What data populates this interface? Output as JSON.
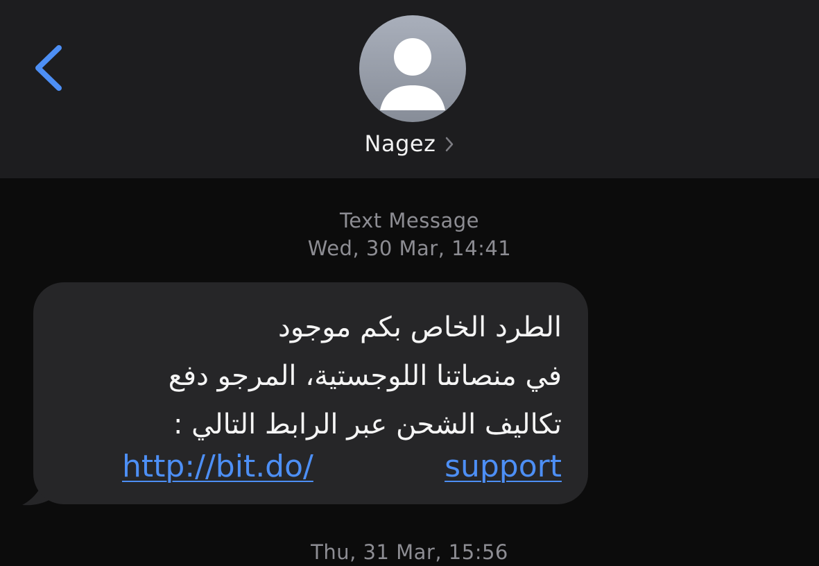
{
  "header": {
    "contact_name": "Nagez",
    "back_icon": "chevron-left-icon",
    "avatar_icon": "person-silhouette-icon",
    "accent_color": "#4d8ff5"
  },
  "conversation": {
    "message_type": "Text Message",
    "timestamp": "Wed, 30 Mar, 14:41",
    "message": {
      "lines": [
        "الطرد الخاص بكم موجود",
        "في منصاتنا اللوجستية، المرجو دفع",
        "تكاليف الشحن عبر الرابط التالي :"
      ],
      "link_part_1": "http://bit.do/",
      "link_part_2": "support"
    },
    "next_timestamp": "Thu, 31 Mar, 15:56"
  }
}
